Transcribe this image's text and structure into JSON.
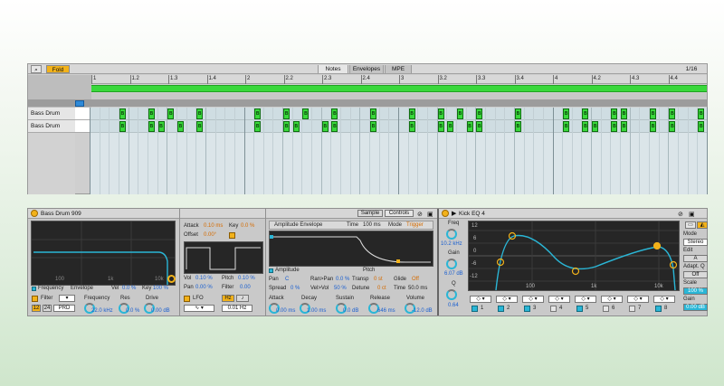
{
  "clip": {
    "toolbar": {
      "fold_label": "Fold",
      "tabs": [
        "Notes",
        "Envelopes",
        "MPE"
      ],
      "grid": "1/16"
    },
    "ruler": [
      "1",
      "1.2",
      "1.3",
      "1.4",
      "2",
      "2.2",
      "2.3",
      "2.4",
      "3",
      "3.2",
      "3.3",
      "3.4",
      "4",
      "4.2",
      "4.3",
      "4.4"
    ],
    "lanes": [
      "Bass Drum",
      "Bass Drum"
    ],
    "note_letter": "B"
  },
  "drum": {
    "title": "Bass Drum 909",
    "tabs": {
      "sample": "Sample",
      "controls": "Controls"
    },
    "display": {
      "ticks": [
        "100",
        "1k",
        "10k"
      ],
      "legend_freq": "Frequency",
      "legend_env": "Envelope",
      "vel_label": "Vel",
      "vel": "0.0 %",
      "key_label": "Key",
      "key": "100 %"
    },
    "filter": {
      "label": "Filter",
      "b12": "12",
      "b24": "24",
      "type": "PRD",
      "freq_label": "Frequency",
      "freq": "22.0 kHz",
      "res_label": "Res",
      "res": "0.0 %",
      "drive_label": "Drive",
      "drive": "0.00 dB"
    },
    "env": {
      "attack_label": "Attack",
      "attack": "0.10 ms",
      "key_label": "Key",
      "key": "0.0 %",
      "offset_label": "Offset",
      "offset": "0.00°",
      "vol_label": "Vol",
      "vol": "0.10 %",
      "pitch_label": "Pitch",
      "pitch": "0.10 %",
      "pan_label": "Pan",
      "pan": "0.00 %",
      "filter_label": "Filter",
      "filter": "0.00"
    },
    "lfo": {
      "label": "LFO",
      "hz": "Hz",
      "rate": "0.01 Hz"
    },
    "amp": {
      "title": "Amplitude Envelope",
      "time_label": "Time",
      "time": "100 ms",
      "mode_label": "Mode",
      "mode": "Trigger",
      "legend_amp": "Amplitude",
      "legend_pitch": "Pitch",
      "pan_label": "Pan",
      "pan": "C",
      "ranpan_label": "Ran>Pan",
      "ranpan": "0.0 %",
      "transp_label": "Transp",
      "transp": "0 st",
      "glide_label": "Glide",
      "glide": "Off",
      "spread_label": "Spread",
      "spread": "0 %",
      "velvol_label": "Vel>Vol",
      "velvol": "50 %",
      "detune_label": "Detune",
      "detune": "0 ct",
      "time2_label": "Time",
      "time2": "50.0 ms"
    },
    "knobs": [
      {
        "label": "Attack",
        "value": "0.00 ms"
      },
      {
        "label": "Decay",
        "value": "1.00 ms"
      },
      {
        "label": "Sustain",
        "value": "0.0 dB"
      },
      {
        "label": "Release",
        "value": "646 ms"
      },
      {
        "label": "Volume",
        "value": "-12.0 dB"
      }
    ]
  },
  "eq": {
    "title": "Kick EQ 4",
    "freq_label": "Freq",
    "freq": "10.2 kHz",
    "gain_label": "Gain",
    "gain": "6.07 dB",
    "q_label": "Q",
    "q": "0.64",
    "y_ticks": [
      "12",
      "6",
      "0",
      "-6",
      "-12"
    ],
    "x_ticks": [
      "100",
      "1k",
      "10k"
    ],
    "bands": [
      "1",
      "2",
      "3",
      "4",
      "5",
      "6",
      "7",
      "8"
    ],
    "side": {
      "mode_label": "Mode",
      "mode": "Stereo",
      "edit_label": "Edit",
      "edit": "A",
      "adapt_label": "Adapt. Q",
      "adapt": "Off",
      "scale_label": "Scale",
      "scale": "100 %",
      "gain_label": "Gain",
      "gain": "0.00 dB"
    }
  }
}
